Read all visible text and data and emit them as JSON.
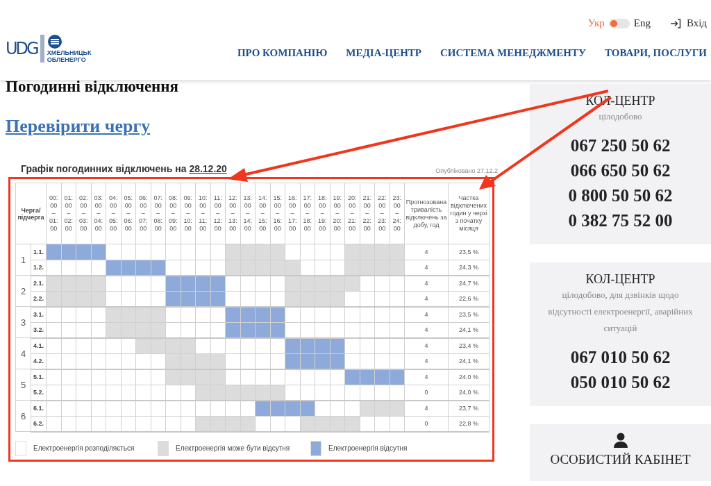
{
  "header": {
    "logo": {
      "mark": "UDG",
      "name_lines": [
        "ХМЕЛЬНИЦЬК",
        "ОБЛЕНЕРГО"
      ]
    },
    "languages": [
      {
        "label": "Укр",
        "selected": true
      },
      {
        "label": "Eng",
        "selected": false
      }
    ],
    "login": "Вхід",
    "nav": [
      "ПРО КОМПАНІЮ",
      "МЕДІА-ЦЕНТР",
      "СИСТЕМА МЕНЕДЖМЕНТУ",
      "ТОВАРИ, ПОСЛУГИ"
    ]
  },
  "page_title": "Погодинні відключення",
  "check_link": "Перевірити чергу",
  "schedule": {
    "title": "Графік погодинних відключень на",
    "date": "28.12.20",
    "published": "Опубліковано 27.12.2",
    "queue_header": "Черга/ підчерга",
    "hours": [
      "00: 00 – 01: 00",
      "01: 00 – 02: 00",
      "02: 00 – 03: 00",
      "03: 00 – 04: 00",
      "04: 00 – 05: 00",
      "05: 00 – 06: 00",
      "06: 00 – 07: 00",
      "07: 00 – 08: 00",
      "08: 00 – 09: 00",
      "09: 00 – 10: 00",
      "10: 00 – 11: 00",
      "11: 00 – 12: 00",
      "12: 00 – 13: 00",
      "13: 00 – 14: 00",
      "14: 00 – 15: 00",
      "15: 00 – 16: 00",
      "16: 00 – 17: 00",
      "17: 00 – 18: 00",
      "18: 00 – 19: 00",
      "19: 00 – 20: 00",
      "20: 00 – 21: 00",
      "21: 00 – 22: 00",
      "22: 00 – 23: 00",
      "23: 00 – 24: 00"
    ],
    "duration_header": "Прогнозована тривалість відключень за добу, год",
    "share_header": "Частка відключених годин у черзі з початку місяця",
    "queues": [
      {
        "number": "1",
        "subqueues": [
          {
            "label": "1.1.",
            "duration": "4",
            "share": "23,5 %",
            "hours": [
              {
                "kind": "off"
              },
              {
                "kind": "off"
              },
              {
                "kind": "off"
              },
              {
                "kind": "off"
              },
              {
                "kind": "on"
              },
              {
                "kind": "on"
              },
              {
                "kind": "on"
              },
              {
                "kind": "on"
              },
              {
                "kind": "on"
              },
              {
                "kind": "on"
              },
              {
                "kind": "on"
              },
              {
                "kind": "on"
              },
              {
                "kind": "maybe"
              },
              {
                "kind": "maybe"
              },
              {
                "kind": "maybe"
              },
              {
                "kind": "maybe"
              },
              {
                "kind": "on"
              },
              {
                "kind": "on"
              },
              {
                "kind": "on"
              },
              {
                "kind": "on"
              },
              {
                "kind": "maybe"
              },
              {
                "kind": "maybe"
              },
              {
                "kind": "maybe"
              },
              {
                "kind": "maybe"
              }
            ]
          },
          {
            "label": "1.2.",
            "duration": "4",
            "share": "24,3 %",
            "hours": [
              {
                "kind": "on"
              },
              {
                "kind": "on"
              },
              {
                "kind": "on"
              },
              {
                "kind": "on"
              },
              {
                "kind": "off"
              },
              {
                "kind": "off"
              },
              {
                "kind": "off"
              },
              {
                "kind": "off"
              },
              {
                "kind": "on"
              },
              {
                "kind": "on"
              },
              {
                "kind": "on"
              },
              {
                "kind": "on"
              },
              {
                "kind": "maybe"
              },
              {
                "kind": "maybe"
              },
              {
                "kind": "maybe"
              },
              {
                "kind": "maybe"
              },
              {
                "kind": "maybe"
              },
              {
                "kind": "on"
              },
              {
                "kind": "on"
              },
              {
                "kind": "on"
              },
              {
                "kind": "maybe"
              },
              {
                "kind": "maybe"
              },
              {
                "kind": "maybe"
              },
              {
                "kind": "maybe"
              }
            ]
          }
        ]
      },
      {
        "number": "2",
        "subqueues": [
          {
            "label": "2.1.",
            "duration": "4",
            "share": "24,7 %",
            "hours": [
              {
                "kind": "maybe"
              },
              {
                "kind": "maybe"
              },
              {
                "kind": "maybe"
              },
              {
                "kind": "maybe"
              },
              {
                "kind": "on"
              },
              {
                "kind": "on"
              },
              {
                "kind": "on"
              },
              {
                "kind": "on"
              },
              {
                "kind": "off"
              },
              {
                "kind": "off"
              },
              {
                "kind": "off"
              },
              {
                "kind": "off"
              },
              {
                "kind": "on"
              },
              {
                "kind": "on"
              },
              {
                "kind": "on"
              },
              {
                "kind": "on"
              },
              {
                "kind": "maybe"
              },
              {
                "kind": "maybe"
              },
              {
                "kind": "maybe"
              },
              {
                "kind": "maybe"
              },
              {
                "kind": "maybe"
              },
              {
                "kind": "on"
              },
              {
                "kind": "on"
              },
              {
                "kind": "on"
              }
            ]
          },
          {
            "label": "2.2.",
            "duration": "4",
            "share": "22,6 %",
            "hours": [
              {
                "kind": "maybe"
              },
              {
                "kind": "maybe"
              },
              {
                "kind": "maybe"
              },
              {
                "kind": "maybe"
              },
              {
                "kind": "on"
              },
              {
                "kind": "on"
              },
              {
                "kind": "on"
              },
              {
                "kind": "on"
              },
              {
                "kind": "off"
              },
              {
                "kind": "off"
              },
              {
                "kind": "off"
              },
              {
                "kind": "off"
              },
              {
                "kind": "on"
              },
              {
                "kind": "on"
              },
              {
                "kind": "on"
              },
              {
                "kind": "on"
              },
              {
                "kind": "maybe"
              },
              {
                "kind": "maybe"
              },
              {
                "kind": "maybe"
              },
              {
                "kind": "maybe"
              },
              {
                "kind": "on"
              },
              {
                "kind": "on"
              },
              {
                "kind": "on"
              },
              {
                "kind": "on"
              }
            ]
          }
        ]
      },
      {
        "number": "3",
        "subqueues": [
          {
            "label": "3.1.",
            "duration": "4",
            "share": "23,5 %",
            "hours": [
              {
                "kind": "on"
              },
              {
                "kind": "on"
              },
              {
                "kind": "on"
              },
              {
                "kind": "on"
              },
              {
                "kind": "maybe"
              },
              {
                "kind": "maybe"
              },
              {
                "kind": "maybe"
              },
              {
                "kind": "maybe"
              },
              {
                "kind": "on"
              },
              {
                "kind": "on"
              },
              {
                "kind": "on"
              },
              {
                "kind": "on"
              },
              {
                "kind": "off"
              },
              {
                "kind": "off"
              },
              {
                "kind": "off"
              },
              {
                "kind": "off"
              },
              {
                "kind": "on"
              },
              {
                "kind": "on"
              },
              {
                "kind": "on"
              },
              {
                "kind": "on"
              },
              {
                "kind": "on"
              },
              {
                "kind": "on"
              },
              {
                "kind": "on"
              },
              {
                "kind": "on"
              }
            ]
          },
          {
            "label": "3.2.",
            "duration": "4",
            "share": "24,1 %",
            "hours": [
              {
                "kind": "on"
              },
              {
                "kind": "on"
              },
              {
                "kind": "on"
              },
              {
                "kind": "on"
              },
              {
                "kind": "maybe"
              },
              {
                "kind": "maybe"
              },
              {
                "kind": "maybe"
              },
              {
                "kind": "maybe"
              },
              {
                "kind": "on"
              },
              {
                "kind": "on"
              },
              {
                "kind": "on"
              },
              {
                "kind": "on"
              },
              {
                "kind": "off"
              },
              {
                "kind": "off"
              },
              {
                "kind": "off"
              },
              {
                "kind": "off"
              },
              {
                "kind": "on"
              },
              {
                "kind": "on"
              },
              {
                "kind": "on"
              },
              {
                "kind": "on"
              },
              {
                "kind": "on"
              },
              {
                "kind": "on"
              },
              {
                "kind": "on"
              },
              {
                "kind": "on"
              }
            ]
          }
        ]
      },
      {
        "number": "4",
        "subqueues": [
          {
            "label": "4.1.",
            "duration": "4",
            "share": "23,4 %",
            "hours": [
              {
                "kind": "on"
              },
              {
                "kind": "on"
              },
              {
                "kind": "on"
              },
              {
                "kind": "on"
              },
              {
                "kind": "on"
              },
              {
                "kind": "on"
              },
              {
                "kind": "maybe"
              },
              {
                "kind": "maybe"
              },
              {
                "kind": "maybe"
              },
              {
                "kind": "maybe"
              },
              {
                "kind": "on"
              },
              {
                "kind": "on"
              },
              {
                "kind": "on"
              },
              {
                "kind": "on"
              },
              {
                "kind": "on"
              },
              {
                "kind": "on"
              },
              {
                "kind": "off"
              },
              {
                "kind": "off"
              },
              {
                "kind": "off"
              },
              {
                "kind": "off"
              },
              {
                "kind": "on"
              },
              {
                "kind": "on"
              },
              {
                "kind": "on"
              },
              {
                "kind": "on"
              }
            ]
          },
          {
            "label": "4.2.",
            "duration": "4",
            "share": "24,1 %",
            "hours": [
              {
                "kind": "on"
              },
              {
                "kind": "on"
              },
              {
                "kind": "on"
              },
              {
                "kind": "on"
              },
              {
                "kind": "on"
              },
              {
                "kind": "on"
              },
              {
                "kind": "on"
              },
              {
                "kind": "on"
              },
              {
                "kind": "maybe"
              },
              {
                "kind": "maybe"
              },
              {
                "kind": "maybe"
              },
              {
                "kind": "maybe"
              },
              {
                "kind": "on"
              },
              {
                "kind": "on"
              },
              {
                "kind": "on"
              },
              {
                "kind": "on"
              },
              {
                "kind": "off"
              },
              {
                "kind": "off"
              },
              {
                "kind": "off"
              },
              {
                "kind": "off"
              },
              {
                "kind": "on"
              },
              {
                "kind": "on"
              },
              {
                "kind": "on"
              },
              {
                "kind": "on"
              }
            ]
          }
        ]
      },
      {
        "number": "5",
        "subqueues": [
          {
            "label": "5.1.",
            "duration": "4",
            "share": "24,0 %",
            "hours": [
              {
                "kind": "on"
              },
              {
                "kind": "on"
              },
              {
                "kind": "on"
              },
              {
                "kind": "on"
              },
              {
                "kind": "on"
              },
              {
                "kind": "on"
              },
              {
                "kind": "on"
              },
              {
                "kind": "on"
              },
              {
                "kind": "maybe"
              },
              {
                "kind": "maybe"
              },
              {
                "kind": "maybe"
              },
              {
                "kind": "maybe"
              },
              {
                "kind": "on"
              },
              {
                "kind": "on"
              },
              {
                "kind": "on"
              },
              {
                "kind": "on"
              },
              {
                "kind": "on"
              },
              {
                "kind": "on"
              },
              {
                "kind": "on"
              },
              {
                "kind": "on"
              },
              {
                "kind": "off"
              },
              {
                "kind": "off"
              },
              {
                "kind": "off"
              },
              {
                "kind": "off"
              }
            ]
          },
          {
            "label": "5.2.",
            "duration": "0",
            "share": "24,0 %",
            "hours": [
              {
                "kind": "on"
              },
              {
                "kind": "on"
              },
              {
                "kind": "on"
              },
              {
                "kind": "on"
              },
              {
                "kind": "on"
              },
              {
                "kind": "on"
              },
              {
                "kind": "on"
              },
              {
                "kind": "on"
              },
              {
                "kind": "on"
              },
              {
                "kind": "on"
              },
              {
                "kind": "maybe"
              },
              {
                "kind": "maybe"
              },
              {
                "kind": "maybe"
              },
              {
                "kind": "maybe"
              },
              {
                "kind": "maybe"
              },
              {
                "kind": "maybe"
              },
              {
                "kind": "on"
              },
              {
                "kind": "on"
              },
              {
                "kind": "on"
              },
              {
                "kind": "on"
              },
              {
                "kind": "on"
              },
              {
                "kind": "on"
              },
              {
                "kind": "on"
              },
              {
                "kind": "on"
              }
            ]
          }
        ]
      },
      {
        "number": "6",
        "subqueues": [
          {
            "label": "6.1.",
            "duration": "4",
            "share": "23,7 %",
            "hours": [
              {
                "kind": "on"
              },
              {
                "kind": "on"
              },
              {
                "kind": "on"
              },
              {
                "kind": "on"
              },
              {
                "kind": "on"
              },
              {
                "kind": "on"
              },
              {
                "kind": "on"
              },
              {
                "kind": "on"
              },
              {
                "kind": "on"
              },
              {
                "kind": "on"
              },
              {
                "kind": "on"
              },
              {
                "kind": "on"
              },
              {
                "kind": "on"
              },
              {
                "kind": "on"
              },
              {
                "kind": "off"
              },
              {
                "kind": "off"
              },
              {
                "kind": "off"
              },
              {
                "kind": "off"
              },
              {
                "kind": "on"
              },
              {
                "kind": "on"
              },
              {
                "kind": "on"
              },
              {
                "kind": "maybe"
              },
              {
                "kind": "maybe"
              },
              {
                "kind": "maybe"
              }
            ]
          },
          {
            "label": "6.2.",
            "duration": "0",
            "share": "22,8 %",
            "hours": [
              {
                "kind": "on"
              },
              {
                "kind": "on"
              },
              {
                "kind": "on"
              },
              {
                "kind": "on"
              },
              {
                "kind": "on"
              },
              {
                "kind": "on"
              },
              {
                "kind": "on"
              },
              {
                "kind": "on"
              },
              {
                "kind": "on"
              },
              {
                "kind": "on"
              },
              {
                "kind": "maybe"
              },
              {
                "kind": "maybe"
              },
              {
                "kind": "maybe"
              },
              {
                "kind": "maybe"
              },
              {
                "kind": "on"
              },
              {
                "kind": "on"
              },
              {
                "kind": "on"
              },
              {
                "kind": "maybe"
              },
              {
                "kind": "maybe"
              },
              {
                "kind": "maybe"
              },
              {
                "kind": "maybe"
              },
              {
                "kind": "on"
              },
              {
                "kind": "on"
              },
              {
                "kind": "on"
              }
            ]
          }
        ]
      }
    ],
    "legend": [
      {
        "kind": "on",
        "label": "Електроенергія розподіляється"
      },
      {
        "kind": "maybe",
        "label": "Електроенергія може бути відсутня"
      },
      {
        "kind": "off",
        "label": "Електроенергія відсутня"
      }
    ]
  },
  "sidebar": [
    {
      "kind": "phones",
      "title": "КОЛ-ЦЕНТР",
      "subtitle": "цілодобово",
      "phones": [
        "067 250 50 62",
        "066 650 50 62",
        "0 800 50 50 62",
        "0 382 75 52 00"
      ]
    },
    {
      "kind": "phones",
      "title": "КОЛ-ЦЕНТР",
      "subtitle": "цілодобово, для дзвінків щодо відсутності електроенергії, аварійних ситуацій",
      "phones": [
        "067 010 50 62",
        "050 010 50 62"
      ]
    },
    {
      "kind": "account",
      "title": "ОСОБИСТИЙ КАБІНЕТ"
    }
  ]
}
